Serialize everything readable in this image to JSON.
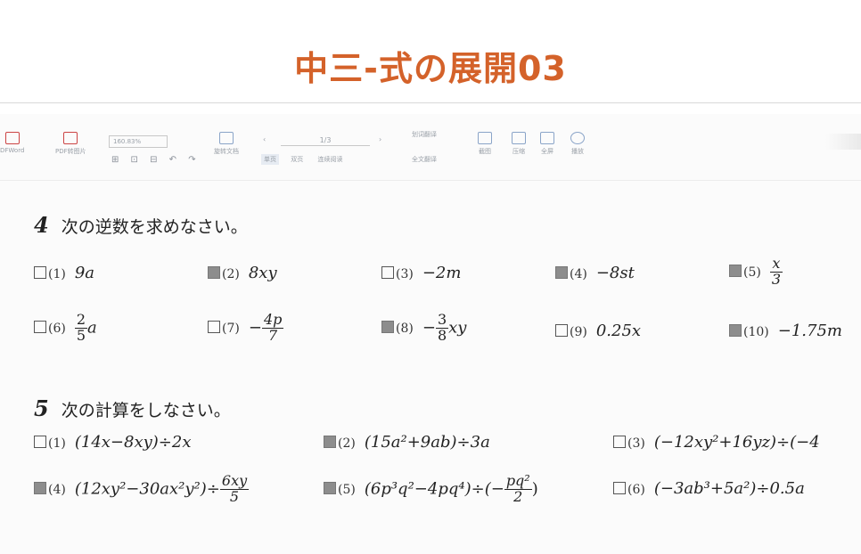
{
  "banner": {
    "title": "中三-式の展開03"
  },
  "toolbar": {
    "items": [
      "DFWord",
      "PDF转图片",
      "旋转文档",
      "单页",
      "双页",
      "连续阅读",
      "划词翻译",
      "全文翻译",
      "截图",
      "压缩",
      "全屏",
      "播放"
    ],
    "zoom": "160.83%",
    "page": "1/3",
    "small_icons": "⊞ ⊡ ⊟ ↶ ↷"
  },
  "section4": {
    "number": "4",
    "instruction": "次の逆数を求めなさい。",
    "problems": [
      {
        "num": "(1)",
        "expr": "9a",
        "checked": false
      },
      {
        "num": "(2)",
        "expr": "8xy",
        "checked": true
      },
      {
        "num": "(3)",
        "expr": "−2m",
        "checked": false
      },
      {
        "num": "(4)",
        "expr": "−8st",
        "checked": true
      },
      {
        "num": "(5)",
        "frac_n": "x",
        "frac_d": "3",
        "checked": true
      },
      {
        "num": "(6)",
        "frac_n": "2",
        "frac_d": "5",
        "suffix": "a",
        "checked": false
      },
      {
        "num": "(7)",
        "prefix": "−",
        "frac_n": "4p",
        "frac_d": "7",
        "checked": false
      },
      {
        "num": "(8)",
        "prefix": "−",
        "frac_n": "3",
        "frac_d": "8",
        "suffix": "xy",
        "checked": true
      },
      {
        "num": "(9)",
        "expr": "0.25x",
        "checked": false
      },
      {
        "num": "(10)",
        "expr": "−1.75m",
        "checked": true
      }
    ]
  },
  "section5": {
    "number": "5",
    "instruction": "次の計算をしなさい。",
    "problems": [
      {
        "num": "(1)",
        "expr": "(14x−8xy)÷2x",
        "checked": false
      },
      {
        "num": "(2)",
        "expr": "(15a²+9ab)÷3a",
        "checked": true
      },
      {
        "num": "(3)",
        "expr": "(−12xy²+16yz)÷(−4",
        "checked": false
      },
      {
        "num": "(4)",
        "expr": "(12xy²−30ax²y²)÷",
        "frac_n": "6xy",
        "frac_d": "5",
        "checked": true
      },
      {
        "num": "(5)",
        "expr": "(6p³q²−4pq⁴)÷(−",
        "frac_n": "pq²",
        "frac_d": "2",
        "suffix": ")",
        "checked": true
      },
      {
        "num": "(6)",
        "expr": "(−3ab³+5a²)÷0.5a",
        "checked": false
      }
    ]
  }
}
